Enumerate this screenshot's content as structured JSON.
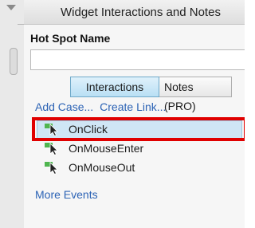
{
  "panel": {
    "title": "Widget Interactions and Notes"
  },
  "hotspot": {
    "label": "Hot Spot Name",
    "value": ""
  },
  "tabs": [
    {
      "label": "Interactions",
      "active": true
    },
    {
      "label": "Notes (PRO)",
      "active": false
    }
  ],
  "actions": {
    "add_case": "Add Case...",
    "create_link": "Create Link..."
  },
  "events": [
    {
      "label": "OnClick",
      "selected": true,
      "icon": "event-cursor-icon"
    },
    {
      "label": "OnMouseEnter",
      "selected": false,
      "icon": "event-cursor-icon"
    },
    {
      "label": "OnMouseOut",
      "selected": false,
      "icon": "event-cursor-icon"
    }
  ],
  "more_events": "More Events",
  "colors": {
    "highlight": "#cfe6f5",
    "annotation": "#e00000",
    "link": "#2c63b5",
    "icon_green": "#4fb54f"
  }
}
